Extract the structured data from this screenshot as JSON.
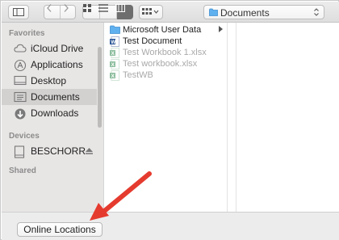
{
  "toolbar": {
    "buttons": [
      {
        "name": "sidebar-toggle-button",
        "icon": "sidebar-icon"
      },
      {
        "name": "back-button",
        "icon": "chevron-left-icon"
      },
      {
        "name": "forward-button",
        "icon": "chevron-right-icon"
      },
      {
        "name": "icon-view-button",
        "icon": "grid-icon"
      },
      {
        "name": "list-view-button",
        "icon": "list-icon"
      },
      {
        "name": "column-view-button",
        "icon": "columns-icon",
        "active": true
      },
      {
        "name": "group-by-button",
        "icon": "grid-dropdown-icon"
      }
    ],
    "location": "Documents",
    "location_icon": "folder-icon"
  },
  "sidebar": {
    "sections": {
      "favorites": "Favorites",
      "devices": "Devices",
      "shared": "Shared"
    },
    "favorites": [
      {
        "label": "iCloud Drive",
        "icon": "cloud-icon"
      },
      {
        "label": "Applications",
        "icon": "applications-icon"
      },
      {
        "label": "Desktop",
        "icon": "desktop-icon"
      },
      {
        "label": "Documents",
        "icon": "documents-icon",
        "selected": true
      },
      {
        "label": "Downloads",
        "icon": "downloads-icon"
      }
    ],
    "devices": [
      {
        "label": "BESCHORR",
        "icon": "drive-icon",
        "eject_icon": "eject-icon"
      }
    ]
  },
  "files": [
    {
      "label": "Microsoft User Data",
      "icon": "folder-icon",
      "has_children": true,
      "dim": false
    },
    {
      "label": "Test Document",
      "icon": "word-doc-icon",
      "dim": false
    },
    {
      "label": "Test Workbook 1.xlsx",
      "icon": "excel-icon",
      "dim": true
    },
    {
      "label": "Test workbook.xlsx",
      "icon": "excel-icon",
      "dim": true
    },
    {
      "label": "TestWB",
      "icon": "excel-icon",
      "dim": true
    }
  ],
  "bottom": {
    "online_locations_label": "Online Locations"
  },
  "colors": {
    "accent_folder": "#5fb0ef",
    "annotation_arrow": "#e53b2f",
    "excel": "#2f8a4f",
    "word": "#2b5797"
  }
}
